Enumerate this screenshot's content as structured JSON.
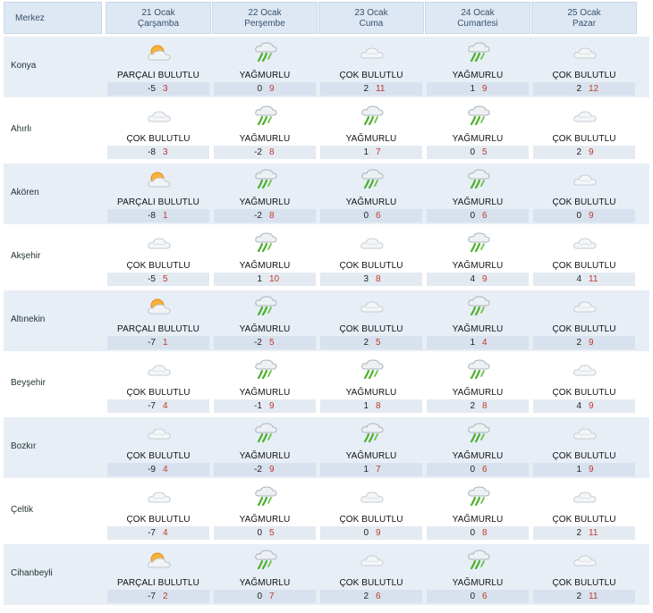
{
  "header": {
    "first_col": "Merkez",
    "days": [
      {
        "date": "21 Ocak",
        "weekday": "Çarşamba"
      },
      {
        "date": "22 Ocak",
        "weekday": "Perşembe"
      },
      {
        "date": "23 Ocak",
        "weekday": "Cuma"
      },
      {
        "date": "24 Ocak",
        "weekday": "Cumartesi"
      },
      {
        "date": "25 Ocak",
        "weekday": "Pazar"
      }
    ]
  },
  "colors": {
    "header_bg": "#dde8f4",
    "row_shade": "#e7eef6",
    "max_temp": "#c0392b"
  },
  "rows": [
    {
      "name": "Konya",
      "days": [
        {
          "cond": "PARÇALI BULUTLU",
          "icon": "sun-cloud-icon",
          "min": "-5",
          "max": "3"
        },
        {
          "cond": "YAĞMURLU",
          "icon": "rain-icon",
          "min": "0",
          "max": "9"
        },
        {
          "cond": "ÇOK BULUTLU",
          "icon": "cloud-icon",
          "min": "2",
          "max": "11"
        },
        {
          "cond": "YAĞMURLU",
          "icon": "rain-icon",
          "min": "1",
          "max": "9"
        },
        {
          "cond": "ÇOK BULUTLU",
          "icon": "cloud-icon",
          "min": "2",
          "max": "12"
        }
      ]
    },
    {
      "name": "Ahırlı",
      "days": [
        {
          "cond": "ÇOK BULUTLU",
          "icon": "cloud-icon",
          "min": "-8",
          "max": "3"
        },
        {
          "cond": "YAĞMURLU",
          "icon": "rain-icon",
          "min": "-2",
          "max": "8"
        },
        {
          "cond": "YAĞMURLU",
          "icon": "rain-icon",
          "min": "1",
          "max": "7"
        },
        {
          "cond": "YAĞMURLU",
          "icon": "rain-icon",
          "min": "0",
          "max": "5"
        },
        {
          "cond": "ÇOK BULUTLU",
          "icon": "cloud-icon",
          "min": "2",
          "max": "9"
        }
      ]
    },
    {
      "name": "Akören",
      "days": [
        {
          "cond": "PARÇALI BULUTLU",
          "icon": "sun-cloud-icon",
          "min": "-8",
          "max": "1"
        },
        {
          "cond": "YAĞMURLU",
          "icon": "rain-icon",
          "min": "-2",
          "max": "8"
        },
        {
          "cond": "YAĞMURLU",
          "icon": "rain-icon",
          "min": "0",
          "max": "6"
        },
        {
          "cond": "YAĞMURLU",
          "icon": "rain-icon",
          "min": "0",
          "max": "6"
        },
        {
          "cond": "ÇOK BULUTLU",
          "icon": "cloud-icon",
          "min": "0",
          "max": "9"
        }
      ]
    },
    {
      "name": "Akşehir",
      "days": [
        {
          "cond": "ÇOK BULUTLU",
          "icon": "cloud-icon",
          "min": "-5",
          "max": "5"
        },
        {
          "cond": "YAĞMURLU",
          "icon": "rain-icon",
          "min": "1",
          "max": "10"
        },
        {
          "cond": "ÇOK BULUTLU",
          "icon": "cloud-icon",
          "min": "3",
          "max": "8"
        },
        {
          "cond": "YAĞMURLU",
          "icon": "rain-icon",
          "min": "4",
          "max": "9"
        },
        {
          "cond": "ÇOK BULUTLU",
          "icon": "cloud-icon",
          "min": "4",
          "max": "11"
        }
      ]
    },
    {
      "name": "Altınekin",
      "days": [
        {
          "cond": "PARÇALI BULUTLU",
          "icon": "sun-cloud-icon",
          "min": "-7",
          "max": "1"
        },
        {
          "cond": "YAĞMURLU",
          "icon": "rain-icon",
          "min": "-2",
          "max": "5"
        },
        {
          "cond": "ÇOK BULUTLU",
          "icon": "cloud-icon",
          "min": "2",
          "max": "5"
        },
        {
          "cond": "YAĞMURLU",
          "icon": "rain-icon",
          "min": "1",
          "max": "4"
        },
        {
          "cond": "ÇOK BULUTLU",
          "icon": "cloud-icon",
          "min": "2",
          "max": "9"
        }
      ]
    },
    {
      "name": "Beyşehir",
      "days": [
        {
          "cond": "ÇOK BULUTLU",
          "icon": "cloud-icon",
          "min": "-7",
          "max": "4"
        },
        {
          "cond": "YAĞMURLU",
          "icon": "rain-icon",
          "min": "-1",
          "max": "9"
        },
        {
          "cond": "YAĞMURLU",
          "icon": "rain-icon",
          "min": "1",
          "max": "8"
        },
        {
          "cond": "YAĞMURLU",
          "icon": "rain-icon",
          "min": "2",
          "max": "8"
        },
        {
          "cond": "ÇOK BULUTLU",
          "icon": "cloud-icon",
          "min": "4",
          "max": "9"
        }
      ]
    },
    {
      "name": "Bozkır",
      "days": [
        {
          "cond": "ÇOK BULUTLU",
          "icon": "cloud-icon",
          "min": "-9",
          "max": "4"
        },
        {
          "cond": "YAĞMURLU",
          "icon": "rain-icon",
          "min": "-2",
          "max": "9"
        },
        {
          "cond": "YAĞMURLU",
          "icon": "rain-icon",
          "min": "1",
          "max": "7"
        },
        {
          "cond": "YAĞMURLU",
          "icon": "rain-icon",
          "min": "0",
          "max": "6"
        },
        {
          "cond": "ÇOK BULUTLU",
          "icon": "cloud-icon",
          "min": "1",
          "max": "9"
        }
      ]
    },
    {
      "name": "Çeltik",
      "days": [
        {
          "cond": "ÇOK BULUTLU",
          "icon": "cloud-icon",
          "min": "-7",
          "max": "4"
        },
        {
          "cond": "YAĞMURLU",
          "icon": "rain-icon",
          "min": "0",
          "max": "5"
        },
        {
          "cond": "ÇOK BULUTLU",
          "icon": "cloud-icon",
          "min": "0",
          "max": "9"
        },
        {
          "cond": "YAĞMURLU",
          "icon": "rain-icon",
          "min": "0",
          "max": "8"
        },
        {
          "cond": "ÇOK BULUTLU",
          "icon": "cloud-icon",
          "min": "2",
          "max": "11"
        }
      ]
    },
    {
      "name": "Cihanbeyli",
      "days": [
        {
          "cond": "PARÇALI BULUTLU",
          "icon": "sun-cloud-icon",
          "min": "-7",
          "max": "2"
        },
        {
          "cond": "YAĞMURLU",
          "icon": "rain-icon",
          "min": "0",
          "max": "7"
        },
        {
          "cond": "ÇOK BULUTLU",
          "icon": "cloud-icon",
          "min": "2",
          "max": "6"
        },
        {
          "cond": "YAĞMURLU",
          "icon": "rain-icon",
          "min": "0",
          "max": "6"
        },
        {
          "cond": "ÇOK BULUTLU",
          "icon": "cloud-icon",
          "min": "2",
          "max": "11"
        }
      ]
    }
  ]
}
